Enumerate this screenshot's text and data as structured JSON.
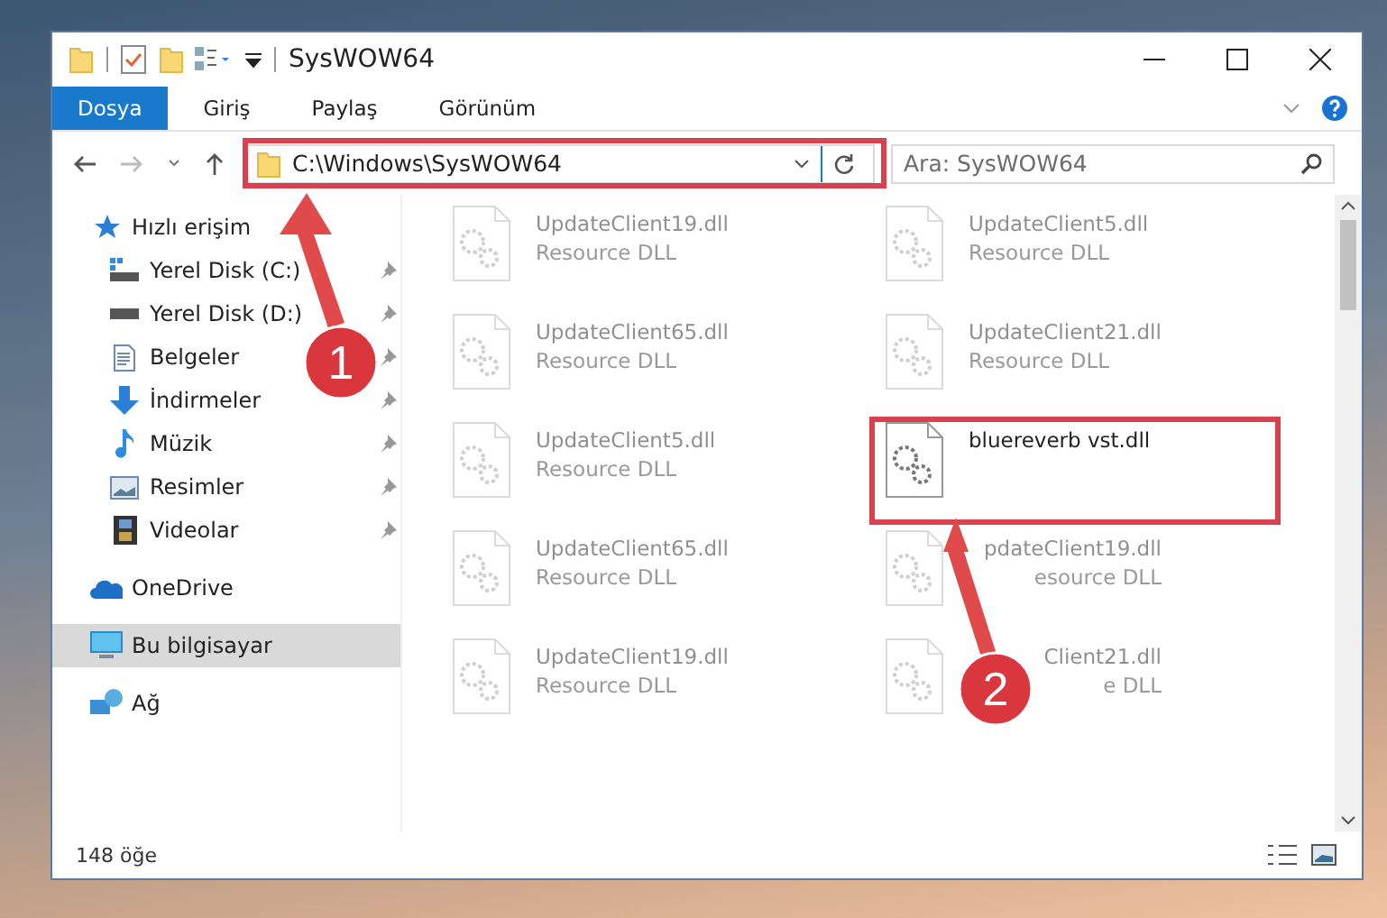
{
  "window": {
    "title": "SysWOW64"
  },
  "ribbon_tabs": [
    {
      "label": "Dosya",
      "selected": true
    },
    {
      "label": "Giriş",
      "selected": false
    },
    {
      "label": "Paylaş",
      "selected": false
    },
    {
      "label": "Görünüm",
      "selected": false
    }
  ],
  "address_bar": {
    "path": "C:\\Windows\\SysWOW64"
  },
  "search": {
    "placeholder": "Ara: SysWOW64"
  },
  "navigation": [
    {
      "label": "Hızlı erişim",
      "kind": "star",
      "selected": false,
      "children": [
        {
          "label": "Yerel Disk (C:)",
          "kind": "system-drive",
          "pinned": true
        },
        {
          "label": "Yerel Disk (D:)",
          "kind": "drive",
          "pinned": true
        },
        {
          "label": "Belgeler",
          "kind": "documents",
          "pinned": true
        },
        {
          "label": "İndirmeler",
          "kind": "downloads",
          "pinned": true
        },
        {
          "label": "Müzik",
          "kind": "music",
          "pinned": true
        },
        {
          "label": "Resimler",
          "kind": "pictures",
          "pinned": true
        },
        {
          "label": "Videolar",
          "kind": "videos",
          "pinned": true
        }
      ]
    },
    {
      "label": "OneDrive",
      "kind": "cloud",
      "selected": false
    },
    {
      "label": "Bu bilgisayar",
      "kind": "computer",
      "selected": true
    },
    {
      "label": "Ağ",
      "kind": "network",
      "selected": false
    }
  ],
  "files": [
    {
      "name": "UpdateClient19.dll",
      "type": "Resource DLL",
      "highlighted": false
    },
    {
      "name": "UpdateClient5.dll",
      "type": "Resource DLL",
      "highlighted": false
    },
    {
      "name": "UpdateClient65.dll",
      "type": "Resource DLL",
      "highlighted": false
    },
    {
      "name": "UpdateClient21.dll",
      "type": "Resource DLL",
      "highlighted": false
    },
    {
      "name": "UpdateClient5.dll",
      "type": "Resource DLL",
      "highlighted": false
    },
    {
      "name": "bluereverb vst.dll",
      "highlighted": true
    },
    {
      "name": "UpdateClient65.dll",
      "type": "Resource DLL",
      "highlighted": false
    },
    {
      "name": "pdateClient19.dll",
      "type": "esource DLL",
      "highlighted": false,
      "kind": "partly-covered"
    },
    {
      "name": "UpdateClient19.dll",
      "type": "Resource DLL",
      "highlighted": false
    },
    {
      "name": "Client21.dll",
      "type": "e DLL",
      "highlighted": false,
      "kind": "partly-covered"
    }
  ],
  "callouts": [
    {
      "number": "1"
    },
    {
      "number": "2"
    }
  ],
  "status_bar": {
    "item_count": "148 öğe"
  }
}
